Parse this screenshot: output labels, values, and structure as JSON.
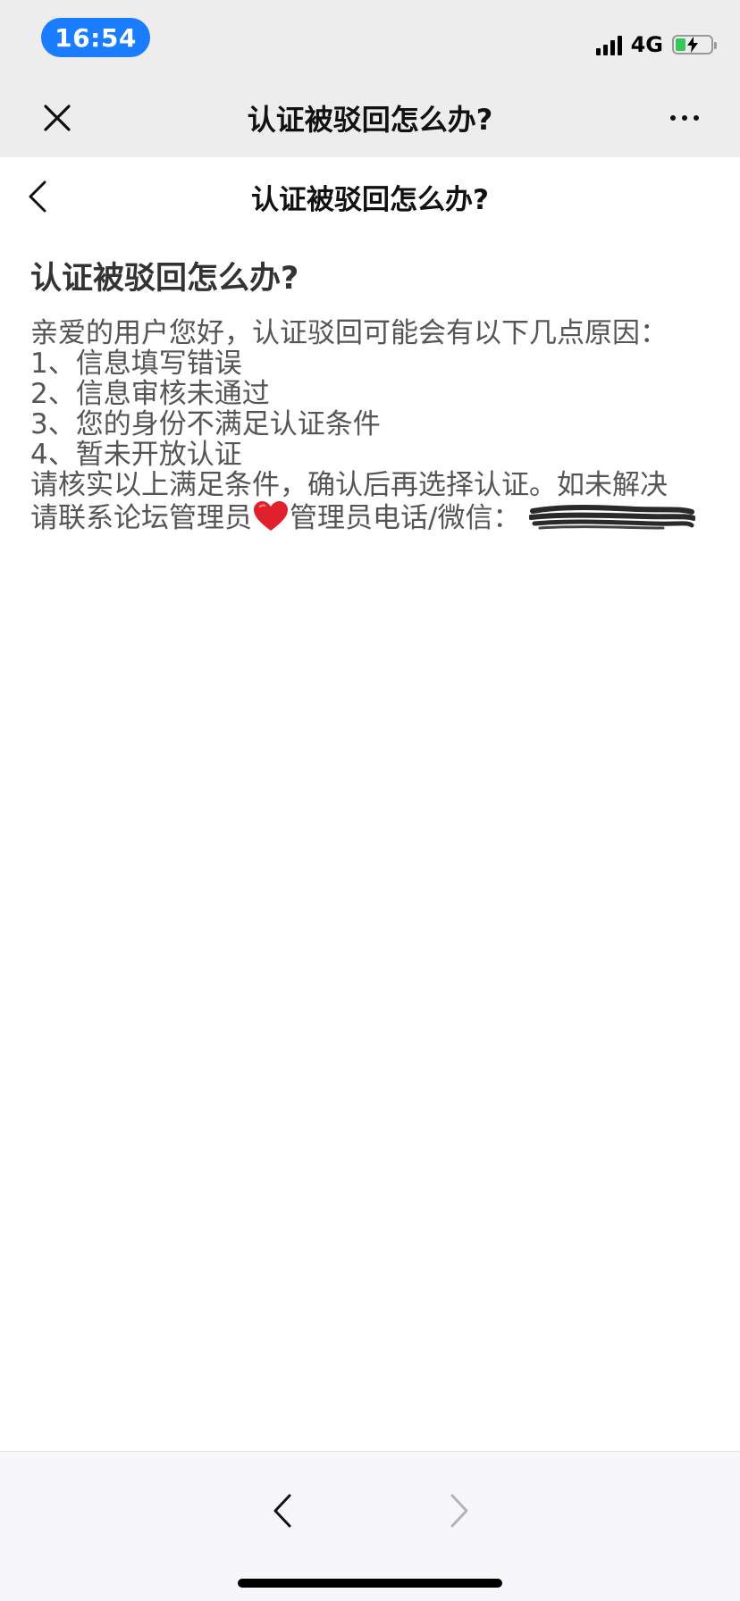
{
  "status_bar": {
    "time": "16:54",
    "network": "4G",
    "battery_level": 0.3,
    "accent_color": "#1a7cff",
    "battery_color": "#34c759"
  },
  "webview_bar": {
    "title": "认证被驳回怎么办?",
    "close_icon": "close-icon",
    "more_icon": "more-dots-icon"
  },
  "page_header": {
    "title": "认证被驳回怎么办?",
    "back_icon": "chevron-left-icon"
  },
  "article": {
    "heading": "认证被驳回怎么办?",
    "lines": [
      "亲爱的用户您好，认证驳回可能会有以下几点原因：",
      "1、信息填写错误",
      "2、信息审核未通过",
      "3、您的身份不满足认证条件",
      "4、暂未开放认证",
      "请核实以上满足条件，确认后再选择认证。如未解决"
    ],
    "contact_prefix": "请联系论坛管理员",
    "contact_suffix": "管理员电话/微信：",
    "heart_icon": "heart-icon",
    "redacted_icon": "redacted-scribble"
  },
  "bottom_bar": {
    "back_icon": "chevron-left-icon",
    "forward_icon": "chevron-right-icon"
  }
}
